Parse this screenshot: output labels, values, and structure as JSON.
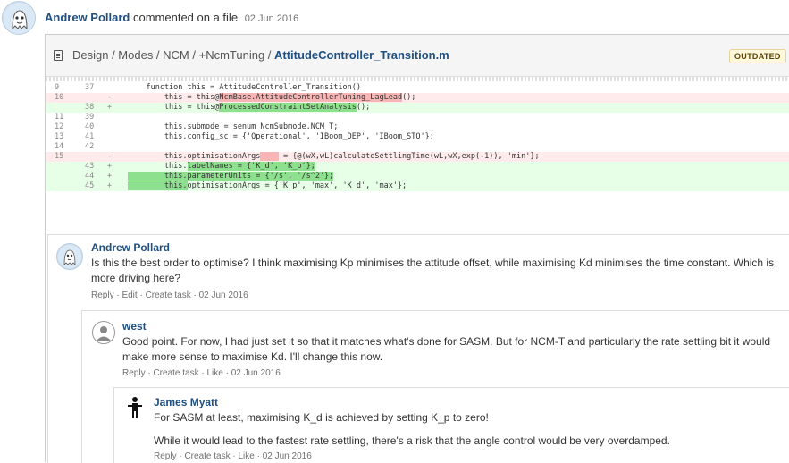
{
  "activity": {
    "user": "Andrew Pollard",
    "action": "commented on a file",
    "date": "02 Jun 2016"
  },
  "file": {
    "path": "Design / Modes / NCM / +NcmTuning / ",
    "filename": "AttitudeController_Transition.m",
    "badge": "OUTDATED"
  },
  "diff": [
    {
      "type": "ctx",
      "old": "9",
      "new": "37",
      "mark": "",
      "code": "    function this = AttitudeController_Transition()"
    },
    {
      "type": "del",
      "old": "10",
      "new": "",
      "mark": "-",
      "pre": "        this = this@",
      "hl": "NcmBase.AttitudeControllerTuning_LagLead",
      "post": "();"
    },
    {
      "type": "add",
      "old": "",
      "new": "38",
      "mark": "+",
      "pre": "        this = this@",
      "hl": "ProcessedConstraintSetAnalysis",
      "post": "();"
    },
    {
      "type": "ctx",
      "old": "11",
      "new": "39",
      "mark": "",
      "code": ""
    },
    {
      "type": "ctx",
      "old": "12",
      "new": "40",
      "mark": "",
      "code": "        this.submode = senum_NcmSubmode.NCM_T;"
    },
    {
      "type": "ctx",
      "old": "13",
      "new": "41",
      "mark": "",
      "code": "        this.config_sc = {'Operational', 'IBoom_DEP', 'IBoom_STO'};"
    },
    {
      "type": "ctx",
      "old": "14",
      "new": "42",
      "mark": "",
      "code": ""
    },
    {
      "type": "del",
      "old": "15",
      "new": "",
      "mark": "-",
      "pre": "        this.optimisationArgs",
      "hl": "    ",
      "post": " = {@(wX,wL)calculateSettlingTime(wL,wX,exp(-1)), 'min'};"
    },
    {
      "type": "add",
      "old": "",
      "new": "43",
      "mark": "+",
      "pre": "        this.",
      "hl": "labelNames = {'K_d', 'K_p'};",
      "post": ""
    },
    {
      "type": "add",
      "old": "",
      "new": "44",
      "mark": "+",
      "pre": "",
      "hl": "        this.parameterUnits = {'/s', '/s^2'};",
      "post": ""
    },
    {
      "type": "add",
      "old": "",
      "new": "45",
      "mark": "+",
      "pre": "",
      "hl": "        this.",
      "post": "optimisationArgs = {'K_p', 'max', 'K_d', 'max'};"
    }
  ],
  "comments": {
    "c1": {
      "author": "Andrew Pollard",
      "text": "Is this the best order to optimise? I think maximising Kp minimises the attitude offset, while maximising Kd minimises the time constant. Which is more driving here?",
      "actions": "Reply · Edit · Create task · 02 Jun 2016"
    },
    "c2": {
      "author": "west",
      "text": "Good point. For now, I had just set it so that it matches what's done for SASM. But for NCM-T and particularly the rate settling bit it would make more sense to maximise Kd. I'll change this now.",
      "actions": "Reply · Create task · Like · 02 Jun 2016"
    },
    "c3": {
      "author": "James Myatt",
      "text1": "For SASM at least, maximising K_d is achieved by setting K_p to zero!",
      "text2": "While it would lead to the fastest rate settling, there's a risk that the angle control would be very overdamped.",
      "actions": "Reply · Create task · Like · 02 Jun 2016"
    }
  },
  "icons": {
    "avatar": "ghost-avatar-icon",
    "default_avatar": "default-user-icon",
    "figure_avatar": "stick-figure-icon",
    "file": "file-icon"
  }
}
